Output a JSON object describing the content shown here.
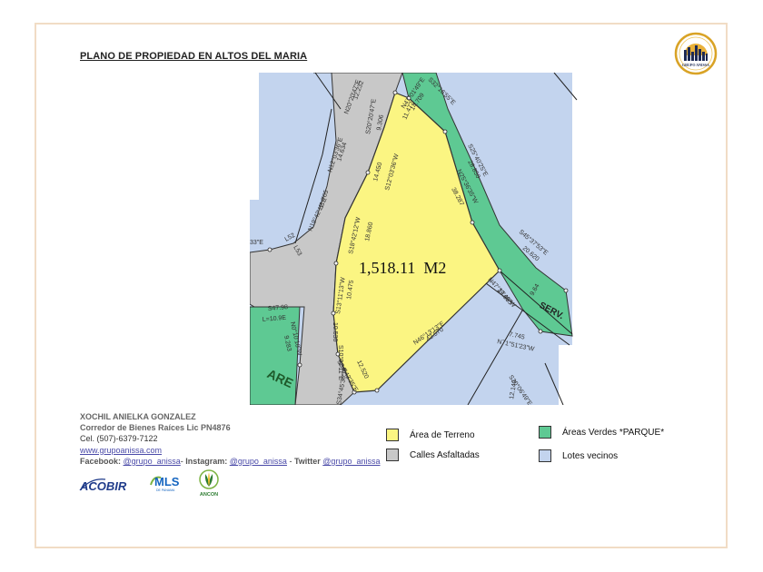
{
  "title": "PLANO DE PROPIEDAD EN ALTOS DEL MARIA",
  "logo": {
    "text": "GRUPO ANISSA",
    "colors": {
      "ring": "#d9a326",
      "sun": "#e9b13a",
      "buildings": "#1d2a54"
    }
  },
  "map": {
    "area_label": "1,518.11  M2",
    "colors": {
      "terreno": "#fbf582",
      "calles": "#c8c8c8",
      "verdes": "#5ec993",
      "lotes": "#c3d4ee"
    },
    "bearings": [
      "S20°20'47\"E",
      "9.306",
      "N20°20'47\"E",
      "12.232",
      "N12°03'36\"E",
      "14.634",
      "N19°42'12\"E",
      "11.705",
      "L52",
      "L53",
      "33\"E",
      "N47°01'49\"E",
      "14.709",
      "S32°16'55\"E",
      "11.472",
      "S12°03'36\"W",
      "14.450",
      "S18°42'12\"W",
      "18.860",
      "S25°40'25\"E",
      "28.850",
      "N25°36'35\"W",
      "38.287",
      "S45°37'53\"E",
      "20.620",
      "9.64",
      "SERV.",
      "S13°11'13\"W",
      "10.475",
      "S10°01'11\"E",
      "10.530",
      "N47°37'49\"W",
      "19.855",
      "N71°51'23\"W",
      "7.745",
      "N46°13'13\"E",
      "42.570",
      "S34°43'35\"E",
      "12.520",
      "S34°45'36\"W",
      "N0°10'10\"W",
      "9.283",
      "S47.98",
      "L=10.9E",
      "ARE",
      "S20°06'49\"E",
      "12.149"
    ]
  },
  "agent": {
    "name": "XOCHIL ANIELKA GONZALEZ",
    "title": "Corredor de Bienes Raíces Lic PN4876",
    "phone": "Cel. (507)-6379-7122",
    "website": "www.grupoanissa.com",
    "social": {
      "facebook_label": "Facebook:",
      "facebook": "@grupo_anissa",
      "sep1": "- ",
      "instagram_label": "Instagram:",
      "instagram": "@grupo_anissa",
      "sep2": " - ",
      "twitter_label": "Twitter",
      "twitter": "@grupo_anissa"
    }
  },
  "legend": [
    {
      "label": "Área de Terreno",
      "color": "#fbf582"
    },
    {
      "label": "Calles Asfaltadas",
      "color": "#c8c8c8"
    },
    {
      "label": "Áreas Verdes *PARQUE*",
      "color": "#5ec993"
    },
    {
      "label": "Lotes vecinos",
      "color": "#c3d4ee"
    }
  ],
  "brands": {
    "acobir": "ACOBIR",
    "mls": "MLS",
    "mls_sub": "DE PANAMA",
    "ancon": "ANCON",
    "colors": {
      "acobir": "#1f3b8a",
      "mls_green": "#7cb342",
      "mls_blue": "#1565c0",
      "ancon": "#2e7d32"
    }
  }
}
